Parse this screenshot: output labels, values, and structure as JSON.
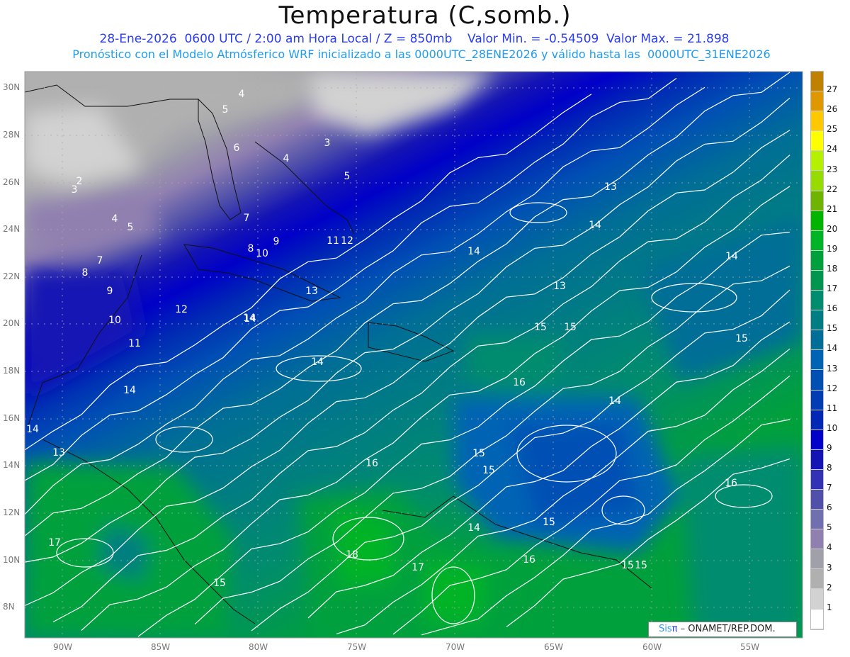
{
  "header": {
    "title": "Temperatura (C,somb.)",
    "subtitle": "28-Ene-2026  0600 UTC / 2:00 am Hora Local / Z = 850mb    Valor Min. = -0.54509  Valor Max. = 21.898",
    "forecast_note": "Pronóstico con el Modelo Atmósferico WRF inicializado a las 0000UTC_28ENE2026 y válido hasta las  0000UTC_31ENE2026"
  },
  "axes": {
    "longitude_labels": [
      "90W",
      "85W",
      "80W",
      "75W",
      "70W",
      "65W",
      "60W",
      "55W"
    ],
    "latitude_labels": [
      "30N",
      "28N",
      "26N",
      "24N",
      "22N",
      "20N",
      "18N",
      "16N",
      "14N",
      "12N",
      "10N",
      "8N"
    ]
  },
  "colorbar": {
    "labels": [
      "27",
      "26",
      "25",
      "24",
      "23",
      "22",
      "21",
      "20",
      "19",
      "18",
      "17",
      "16",
      "15",
      "14",
      "13",
      "12",
      "11",
      "10",
      "9",
      "8",
      "7",
      "6",
      "5",
      "4",
      "3",
      "2",
      "1"
    ],
    "colors": [
      "#c08000",
      "#e09800",
      "#ffc800",
      "#ffff00",
      "#b4f000",
      "#96dc00",
      "#6eb400",
      "#00b400",
      "#00b428",
      "#00a03c",
      "#009650",
      "#008c6e",
      "#007d82",
      "#006e96",
      "#0064b4",
      "#0050b4",
      "#003cb4",
      "#0028b4",
      "#0000c8",
      "#1414b4",
      "#3232b4",
      "#5050aa",
      "#7070b0",
      "#9080b0",
      "#a0a0aa",
      "#b0b0b0",
      "#d2d2d2",
      "#ffffff"
    ]
  },
  "contour_labels": [
    "4",
    "5",
    "6",
    "3",
    "4",
    "5",
    "2",
    "3",
    "4",
    "5",
    "7",
    "8",
    "9",
    "10",
    "11",
    "12",
    "7",
    "8",
    "9",
    "10",
    "11",
    "12",
    "13",
    "14",
    "14",
    "14",
    "13",
    "14",
    "13",
    "14",
    "15",
    "15",
    "16",
    "16",
    "14",
    "14",
    "15",
    "15",
    "14",
    "13",
    "16",
    "15",
    "15",
    "14",
    "15",
    "17",
    "18",
    "17",
    "16",
    "15",
    "14",
    "15"
  ],
  "credit": {
    "brand_sis": "Sis",
    "brand_pi": "π",
    "text": " – ONAMET/REP.DOM."
  }
}
